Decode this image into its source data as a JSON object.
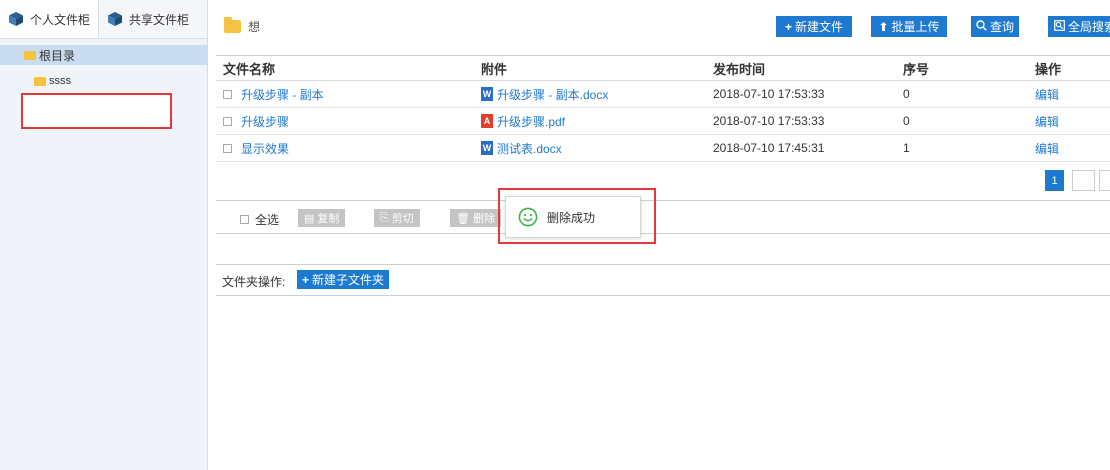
{
  "sidebar": {
    "tabs": [
      {
        "label": "个人文件柜",
        "icon": "cube-icon"
      },
      {
        "label": "共享文件柜",
        "icon": "cube-icon"
      }
    ],
    "tree": {
      "root": "根目录",
      "children": [
        "ssss"
      ]
    }
  },
  "path": {
    "current": "想",
    "icon": "folder-icon"
  },
  "toolbar": {
    "new_file": "新建文件",
    "batch_upload": "批量上传",
    "search": "查询",
    "global_search": "全局搜索"
  },
  "table": {
    "headers": [
      "文件名称",
      "附件",
      "发布时间",
      "序号",
      "操作"
    ],
    "rows": [
      {
        "name": "升级步骤 - 副本",
        "attachment": "升级步骤 - 副本.docx",
        "type": "word",
        "time": "2018-07-10 17:53:33",
        "index": "0",
        "action": "编辑"
      },
      {
        "name": "升级步骤",
        "attachment": "升级步骤.pdf",
        "type": "pdf",
        "time": "2018-07-10 17:53:33",
        "index": "0",
        "action": "编辑"
      },
      {
        "name": "显示效果",
        "attachment": "测试表.docx",
        "type": "word",
        "time": "2018-07-10 17:45:31",
        "index": "1",
        "action": "编辑"
      }
    ]
  },
  "pagination": {
    "current": "1"
  },
  "actions": {
    "select_all": "全选",
    "copy": "复制",
    "cut": "剪切",
    "delete": "删除"
  },
  "toast": {
    "message": "删除成功"
  },
  "folder_ops": {
    "label": "文件夹操作:",
    "new_subfolder": "新建子文件夹"
  },
  "colors": {
    "primary": "#1e7ad1",
    "highlight_red": "#e23a3a",
    "tree_selected": "#c9dcf0",
    "disabled_btn": "#c4c4c4",
    "folder": "#f5c242"
  }
}
